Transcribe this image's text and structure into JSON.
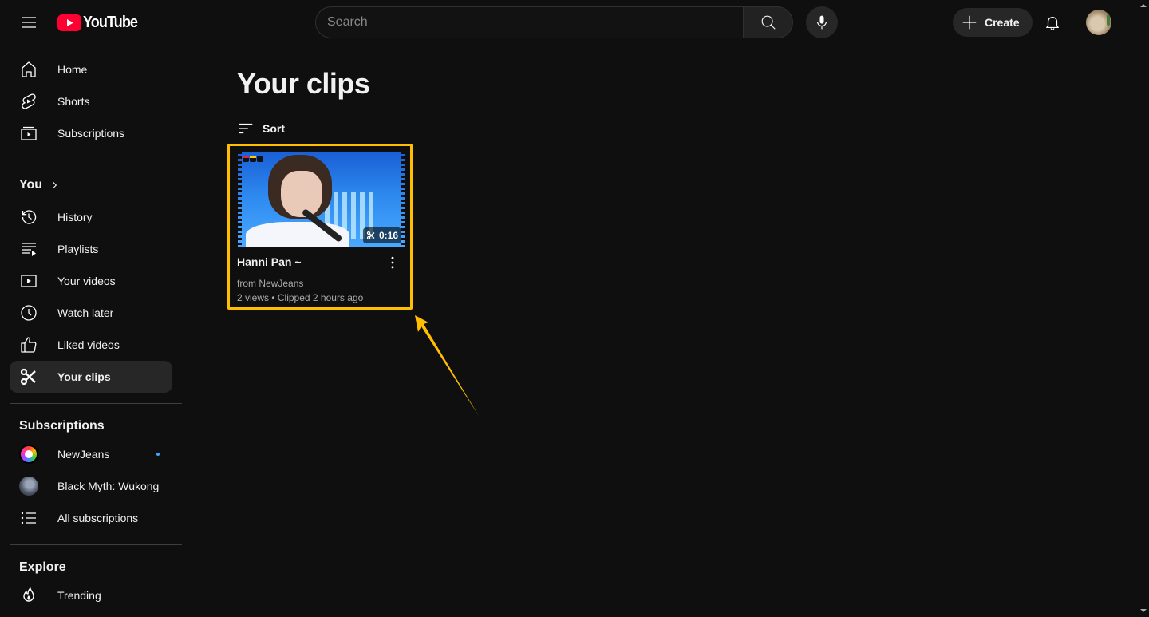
{
  "app": {
    "logo_text": "YouTube",
    "brand_color": "#ff0033",
    "accent_highlight": "#ffbf00"
  },
  "header": {
    "search_placeholder": "Search",
    "search_value": "",
    "create_label": "Create"
  },
  "sidebar": {
    "main_items": [
      {
        "label": "Home",
        "icon": "home-icon"
      },
      {
        "label": "Shorts",
        "icon": "shorts-icon"
      },
      {
        "label": "Subscriptions",
        "icon": "subscriptions-icon"
      }
    ],
    "you_section": {
      "title": "You",
      "items": [
        {
          "label": "History",
          "icon": "history-icon"
        },
        {
          "label": "Playlists",
          "icon": "playlists-icon"
        },
        {
          "label": "Your videos",
          "icon": "your-videos-icon"
        },
        {
          "label": "Watch later",
          "icon": "watch-later-icon"
        },
        {
          "label": "Liked videos",
          "icon": "like-icon"
        },
        {
          "label": "Your clips",
          "icon": "scissors-icon",
          "active": true
        }
      ]
    },
    "subscriptions_section": {
      "title": "Subscriptions",
      "items": [
        {
          "label": "NewJeans",
          "has_new": true
        },
        {
          "label": "Black Myth: Wukong",
          "has_new": false
        },
        {
          "label": "All subscriptions",
          "icon": "list-icon"
        }
      ]
    },
    "explore_section": {
      "title": "Explore",
      "items": [
        {
          "label": "Trending",
          "icon": "trending-icon"
        }
      ]
    }
  },
  "main": {
    "page_title": "Your clips",
    "sort_label": "Sort",
    "clips": [
      {
        "title": "Hanni Pan ~",
        "duration": "0:16",
        "source": "from NewJeans",
        "stats": "2 views • Clipped 2 hours ago"
      }
    ]
  }
}
